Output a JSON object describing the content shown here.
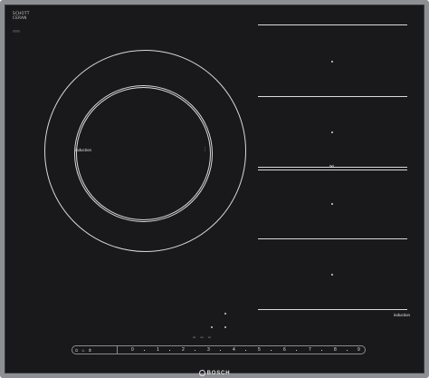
{
  "hob": {
    "maker_mark": "SCHOTT CERAN",
    "maker_sub": "||||||||",
    "zone_label": "induction",
    "flex_label": "induction",
    "brand": "BOSCH",
    "scale": [
      "0",
      "1",
      "2",
      "3",
      "4",
      "5",
      "6",
      "7",
      "8",
      "9"
    ],
    "left_controls": [
      "⏻",
      "♨",
      "⏱"
    ],
    "mid_panel": [
      "▭",
      "▭",
      "▭"
    ],
    "colors": {
      "glass": "#19191b",
      "frame": "#8d8f93",
      "marking": "#d9d9d9"
    }
  }
}
